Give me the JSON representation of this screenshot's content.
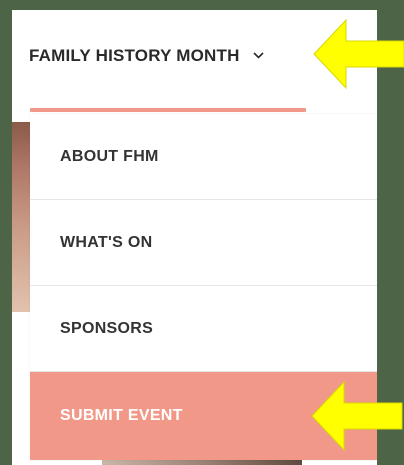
{
  "nav": {
    "title": "FAMILY HISTORY MONTH",
    "chevron": "⌄"
  },
  "menu": {
    "items": [
      {
        "label": "ABOUT FHM"
      },
      {
        "label": "WHAT'S ON"
      },
      {
        "label": "SPONSORS"
      },
      {
        "label": "SUBMIT EVENT",
        "highlighted": true
      }
    ]
  },
  "colors": {
    "background": "#4e6447",
    "accent": "#f29888",
    "highlight_row": "#f29888",
    "arrow": "#ffff00"
  },
  "icons": {
    "chevron": "chevron-down-icon",
    "arrows": "pointer-arrow-icon"
  }
}
